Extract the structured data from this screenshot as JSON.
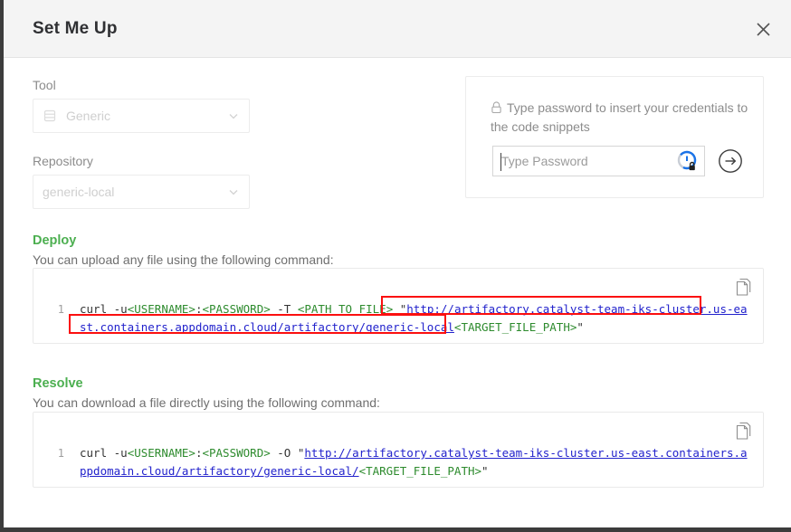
{
  "dialog": {
    "title": "Set Me Up",
    "close_label": "×",
    "close_icon": "close-icon"
  },
  "form": {
    "tool": {
      "label": "Tool",
      "value": "Generic",
      "icon": "database-icon",
      "chevron": "chevron-down-icon"
    },
    "repository": {
      "label": "Repository",
      "value": "generic-local",
      "chevron": "chevron-down-icon"
    }
  },
  "credentials": {
    "hint": "Type password to insert your credentials to the code snippets",
    "hint_icon": "lock-icon",
    "password_placeholder": "Type Password",
    "password_value": "",
    "password_manager_icon": "password-manager-lock-icon",
    "submit_icon": "arrow-right-circle-icon"
  },
  "sections": [
    {
      "title": "Deploy",
      "description": "You can upload any file using the following command:",
      "copy_icon": "copy-icon",
      "line_number": "1",
      "tokens": [
        {
          "text": "curl -u",
          "type": "plain"
        },
        {
          "text": "<USERNAME>",
          "type": "placeholder"
        },
        {
          "text": ":",
          "type": "plain"
        },
        {
          "text": "<PASSWORD>",
          "type": "placeholder"
        },
        {
          "text": " -T ",
          "type": "plain"
        },
        {
          "text": "<PATH_TO_FILE>",
          "type": "placeholder"
        },
        {
          "text": " \"",
          "type": "plain"
        },
        {
          "text": "http://artifactory.catalyst-team-iks-cluster.us-east.containers.appdomain.cloud/artifactory/generic-local",
          "type": "url"
        },
        {
          "text": "<TARGET_FILE_PATH>",
          "type": "placeholder"
        },
        {
          "text": "\"",
          "type": "plain"
        }
      ],
      "command": "curl -u<USERNAME>:<PASSWORD> -T <PATH_TO_FILE> \"http://artifactory.catalyst-team-iks-cluster.us-east.containers.appdomain.cloud/artifactory/generic-local<TARGET_FILE_PATH>\"",
      "highlighted": true
    },
    {
      "title": "Resolve",
      "description": "You can download a file directly using the following command:",
      "copy_icon": "copy-icon",
      "line_number": "1",
      "tokens": [
        {
          "text": "curl -u",
          "type": "plain"
        },
        {
          "text": "<USERNAME>",
          "type": "placeholder"
        },
        {
          "text": ":",
          "type": "plain"
        },
        {
          "text": "<PASSWORD>",
          "type": "placeholder"
        },
        {
          "text": " -O \"",
          "type": "plain"
        },
        {
          "text": "http://artifactory.catalyst-team-iks-cluster.us-east.containers.appdomain.cloud/artifactory/generic-local/",
          "type": "url"
        },
        {
          "text": "<TARGET_FILE_PATH>",
          "type": "placeholder"
        },
        {
          "text": "\"",
          "type": "plain"
        }
      ],
      "command": "curl -u<USERNAME>:<PASSWORD> -O \"http://artifactory.catalyst-team-iks-cluster.us-east.containers.appdomain.cloud/artifactory/generic-local/<TARGET_FILE_PATH>\"",
      "highlighted": false
    }
  ],
  "colors": {
    "header_bg": "#f4f4f4",
    "section_green": "#4caf50",
    "placeholder_green": "#2e8b2e",
    "url_blue": "#2222cc",
    "highlight_red": "#fb0f0f",
    "pwmgr_blue": "#1a73e8"
  }
}
